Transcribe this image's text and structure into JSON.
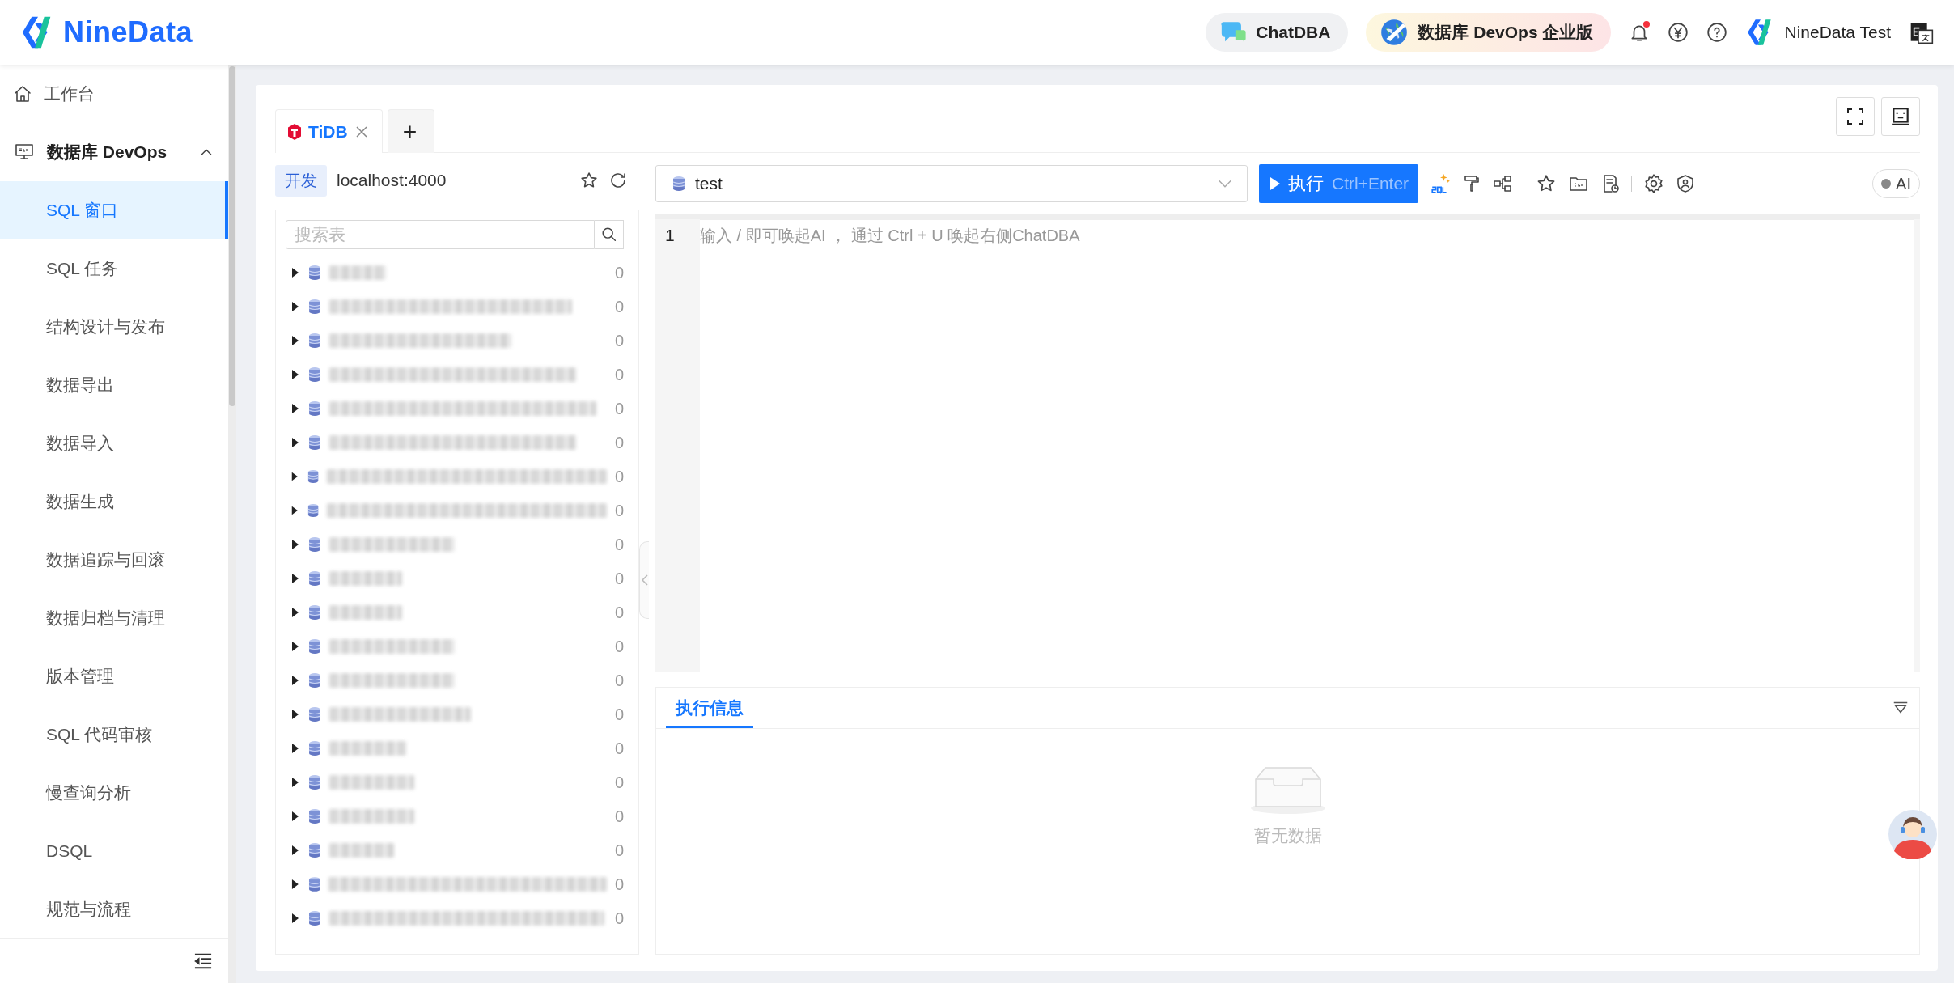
{
  "header": {
    "logo": "NineData",
    "chatdba": "ChatDBA",
    "edition": "数据库 DevOps 企业版",
    "unread_notifications": true,
    "user": "NineData Test"
  },
  "sidebar": {
    "items": [
      {
        "kind": "link",
        "label": "工作台",
        "selected": false
      },
      {
        "kind": "group",
        "label": "数据库 DevOps",
        "expanded": true,
        "children": [
          {
            "label": "SQL 窗口",
            "selected": true
          },
          {
            "label": "SQL 任务",
            "selected": false
          },
          {
            "label": "结构设计与发布",
            "selected": false
          },
          {
            "label": "数据导出",
            "selected": false
          },
          {
            "label": "数据导入",
            "selected": false
          },
          {
            "label": "数据生成",
            "selected": false
          },
          {
            "label": "数据追踪与回滚",
            "selected": false
          },
          {
            "label": "数据归档与清理",
            "selected": false
          },
          {
            "label": "版本管理",
            "selected": false
          },
          {
            "label": "SQL 代码审核",
            "selected": false
          },
          {
            "label": "慢查询分析",
            "selected": false
          },
          {
            "label": "DSQL",
            "selected": false
          },
          {
            "label": "规范与流程",
            "selected": false
          }
        ]
      }
    ]
  },
  "tabs": [
    {
      "label": "TiDB",
      "selected": true
    }
  ],
  "add_tab": "+",
  "connection": {
    "env": "开发",
    "host": "localhost:4000"
  },
  "table_search": {
    "placeholder": "搜索表"
  },
  "databases": [
    {
      "count": "0",
      "expanded": false
    },
    {
      "count": "0",
      "expanded": false
    },
    {
      "count": "0",
      "expanded": false
    },
    {
      "count": "0",
      "expanded": false
    },
    {
      "count": "0",
      "expanded": false
    },
    {
      "count": "0",
      "expanded": false
    },
    {
      "count": "0",
      "expanded": false
    },
    {
      "count": "0",
      "expanded": false
    },
    {
      "count": "0",
      "expanded": false
    },
    {
      "count": "0",
      "expanded": false
    },
    {
      "count": "0",
      "expanded": false
    },
    {
      "count": "0",
      "expanded": false
    },
    {
      "count": "0",
      "expanded": false
    },
    {
      "count": "0",
      "expanded": false
    },
    {
      "count": "0",
      "expanded": false
    },
    {
      "count": "0",
      "expanded": false
    },
    {
      "count": "0",
      "expanded": false
    },
    {
      "count": "0",
      "expanded": false
    },
    {
      "count": "0",
      "expanded": false
    },
    {
      "count": "0",
      "expanded": false
    }
  ],
  "database_select": {
    "value": "test"
  },
  "run_button": {
    "label": "执行",
    "shortcut": "Ctrl+Enter"
  },
  "ai_toggle": {
    "label": "AI",
    "on": false
  },
  "editor": {
    "line_numbers": [
      "1"
    ],
    "placeholder": "输入 / 即可唤起AI ， 通过 Ctrl + U 唤起右侧ChatDBA"
  },
  "results": {
    "tabs": [
      {
        "label": "执行信息",
        "selected": true
      }
    ],
    "empty_text": "暂无数据"
  }
}
